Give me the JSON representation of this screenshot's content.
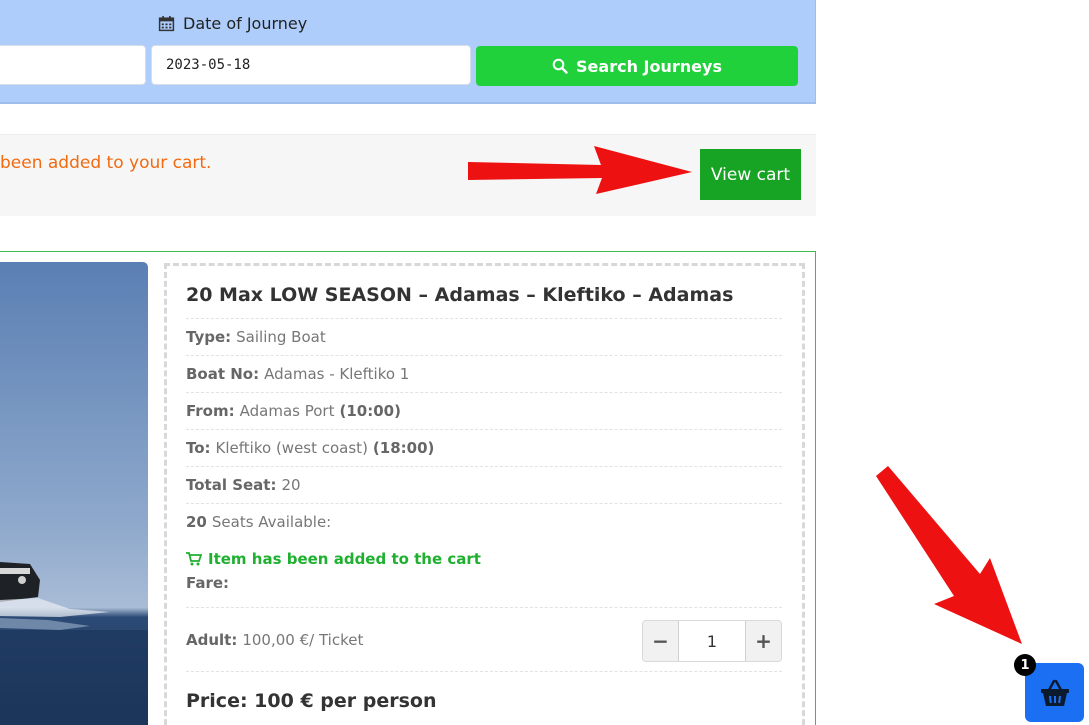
{
  "search": {
    "date_label": "Date of Journey",
    "date_value": "2023-05-18",
    "search_button": "Search Journeys"
  },
  "notice": {
    "message": "been added to your cart.",
    "view_cart": "View cart"
  },
  "journey": {
    "title": "20 Max LOW SEASON – Adamas – Kleftiko – Adamas",
    "type_label": "Type:",
    "type_value": "Sailing Boat",
    "boat_label": "Boat No:",
    "boat_value": "Adamas - Kleftiko 1",
    "from_label": "From:",
    "from_value": "Adamas Port",
    "from_time": "(10:00)",
    "to_label": "To:",
    "to_value": "Kleftiko (west coast)",
    "to_time": "(18:00)",
    "total_seat_label": "Total Seat:",
    "total_seat_value": "20",
    "seats_available_count": "20",
    "seats_available_label": "Seats Available:",
    "added_message": "Item has been added to the cart",
    "fare_label": "Fare:",
    "adult_label": "Adult:",
    "adult_price": "100,00 €/ Ticket",
    "quantity": "1",
    "minus": "−",
    "plus": "+",
    "price_text": "Price: 100 € per person"
  },
  "cart": {
    "badge_count": "1"
  },
  "colors": {
    "panel_bg": "#aecdfb",
    "search_btn": "#21d13b",
    "view_cart_btn": "#17a323",
    "notice_text": "#f26a10",
    "added_text": "#1fb030",
    "arrow": "#ee1111",
    "cart_button": "#1a6ff3"
  }
}
